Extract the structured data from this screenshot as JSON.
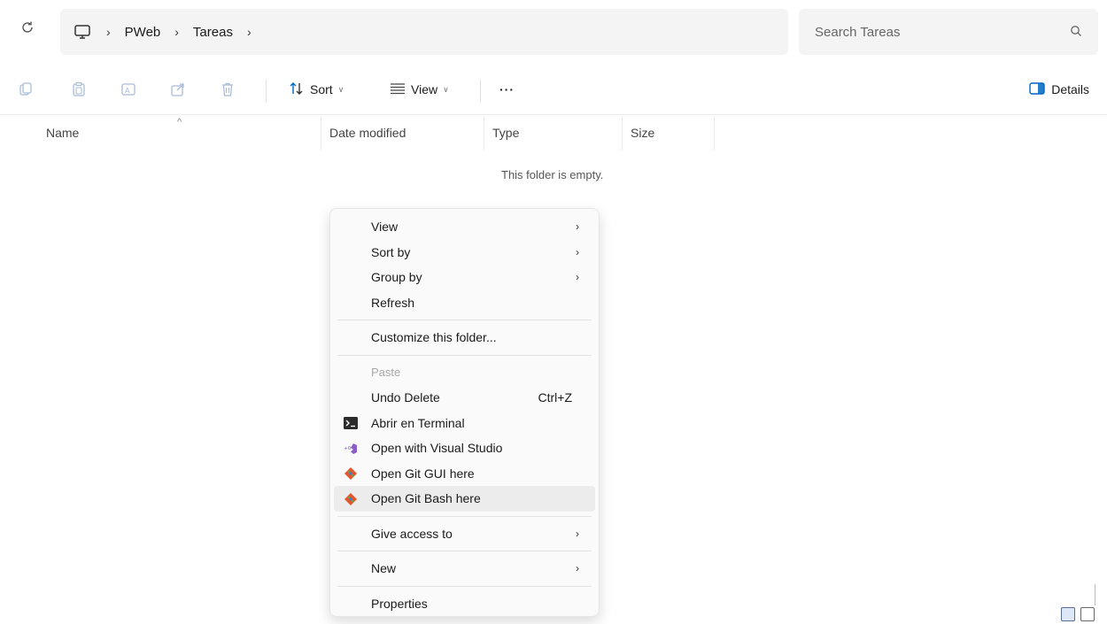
{
  "breadcrumb": {
    "items": [
      "PWeb",
      "Tareas"
    ]
  },
  "search": {
    "placeholder": "Search Tareas"
  },
  "toolbar": {
    "sort_label": "Sort",
    "view_label": "View",
    "more_label": "···",
    "details_label": "Details"
  },
  "columns": {
    "name": "Name",
    "date_modified": "Date modified",
    "type": "Type",
    "size": "Size"
  },
  "empty_message": "This folder is empty.",
  "context_menu": {
    "view": "View",
    "sort_by": "Sort by",
    "group_by": "Group by",
    "refresh": "Refresh",
    "customize": "Customize this folder...",
    "paste": "Paste",
    "undo_delete": "Undo Delete",
    "undo_shortcut": "Ctrl+Z",
    "abrir_terminal": "Abrir en Terminal",
    "open_visual_studio": "Open with Visual Studio",
    "open_git_gui": "Open Git GUI here",
    "open_git_bash": "Open Git Bash here",
    "give_access": "Give access to",
    "new": "New",
    "properties": "Properties"
  },
  "colors": {
    "accent": "#0067c0",
    "vs_purple": "#8a5cc8",
    "git_orange": "#e8552c",
    "menu_bg": "#fafafa",
    "hover_bg": "#ececec"
  }
}
